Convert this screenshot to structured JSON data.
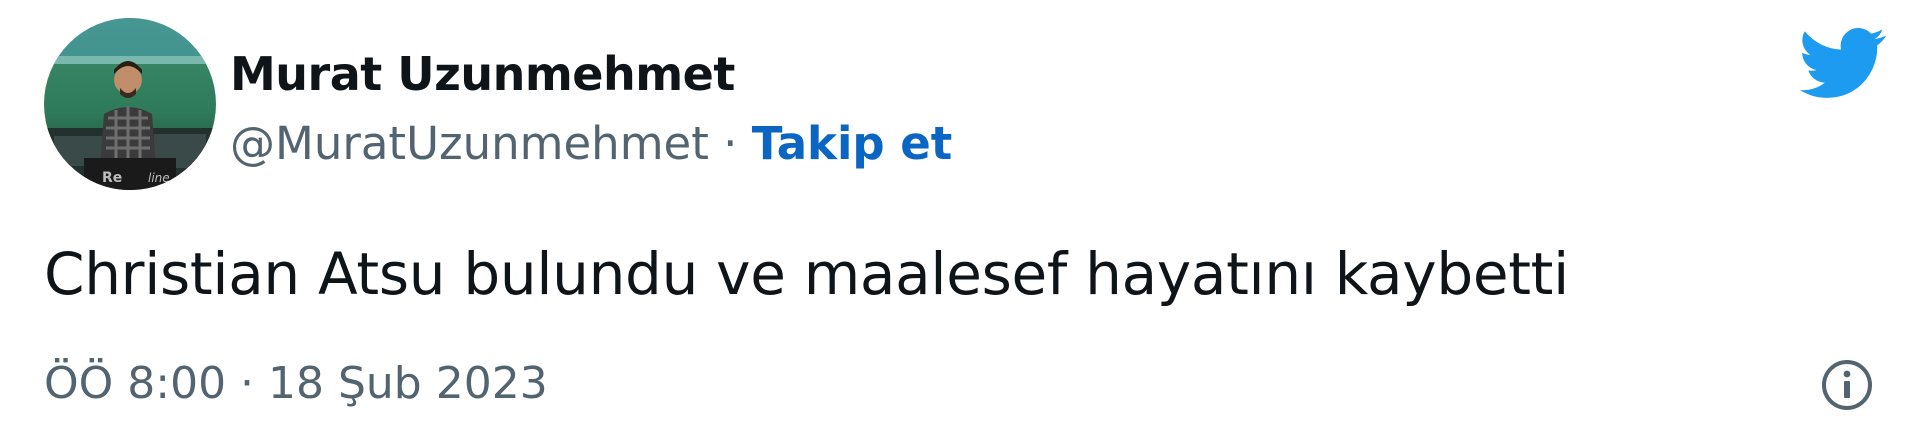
{
  "tweet": {
    "author": {
      "name": "Murat Uzunmehmet",
      "handle": "@MuratUzunmehmet",
      "separator": " · ",
      "follow_label": "Takip et",
      "avatar_icon": "profile-photo"
    },
    "text": "Christian Atsu bulundu ve maalesef hayatını kaybetti",
    "timestamp": "ÖÖ 8:00 · 18 Şub 2023",
    "icons": {
      "brand": "twitter-bird-icon",
      "info": "info-icon"
    },
    "colors": {
      "brand": "#1d9bf0",
      "link": "#0a66c2",
      "secondary_text": "#536471",
      "primary_text": "#0f1419"
    }
  }
}
